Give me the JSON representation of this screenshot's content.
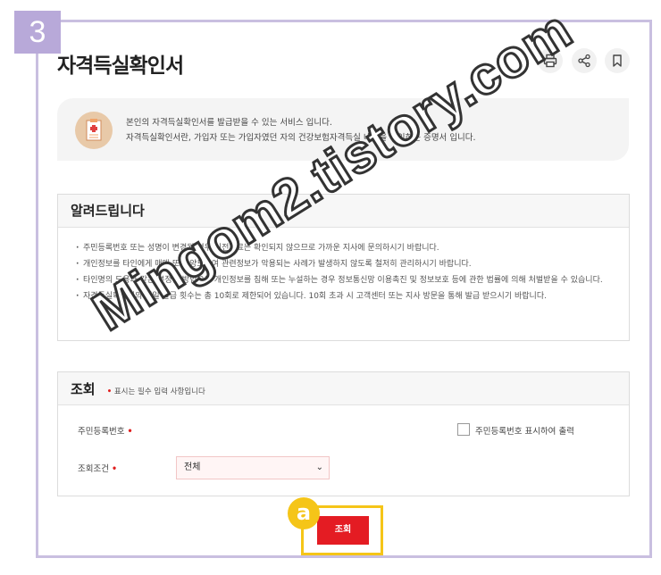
{
  "step_badge": "3",
  "page": {
    "title": "자격득실확인서"
  },
  "toolbar": {
    "print_icon": "print-icon",
    "share_icon": "share-icon",
    "bookmark_icon": "bookmark-icon"
  },
  "intro": {
    "icon": "document-icon",
    "line1": "본인의 자격득실확인서를 발급받을 수 있는 서비스 입니다.",
    "line2": "자격득실확인서란, 가입자 또는 가입자였던 자의 건강보험자격득실 내역을 확인하는 증명서 입니다."
  },
  "notice": {
    "title": "알려드립니다",
    "items": [
      "주민등록번호 또는 성명이 변경된 경우 이전자료는 확인되지 않으므로 가까운 지사에 문의하시기 바랍니다.",
      "개인정보를 타인에게 매매 또는 양도하여 관련정보가 악용되는 사례가 발생하지 않도록 철저히 관리하시기 바랍니다.",
      "타인명의 도용과 같은 부정한 방법으로 개인정보를 침해 또는 누설하는 경우 정보통신망 이용촉진 및 정보보호 등에 관한 법률에 의해 처벌받을 수 있습니다.",
      "자격득실확인서의 일일 발급 횟수는 총 10회로 제한되어 있습니다. 10회 초과 시 고객센터 또는 지사 방문을 통해 발급 받으시기 바랍니다."
    ]
  },
  "query": {
    "title": "조회",
    "required_note": "표시는 필수 입력 사항입니다",
    "rrn_label": "주민등록번호",
    "rrn_value": "",
    "checkbox_label": "주민등록번호 표시하여 출력",
    "condition_label": "조회조건",
    "condition_selected": "전체",
    "search_button": "조회"
  },
  "annotation": {
    "marker": "a"
  },
  "watermark": "Mingom2.tistory.com",
  "colors": {
    "accent": "#e41c23",
    "highlight": "#f5c518",
    "frame": "#c9bfe0"
  }
}
